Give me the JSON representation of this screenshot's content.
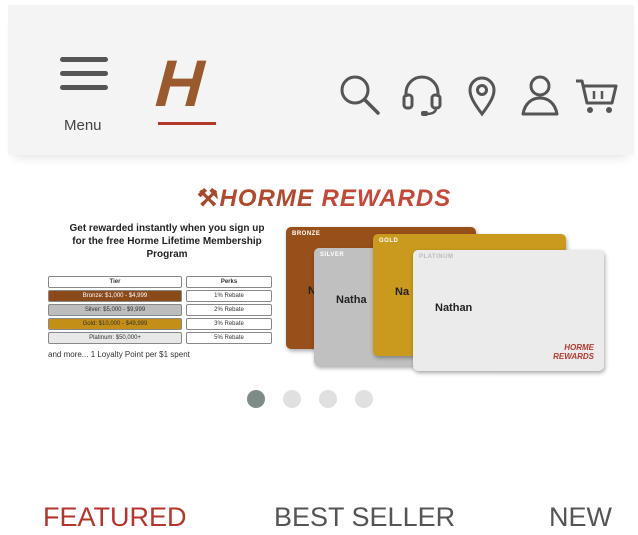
{
  "header": {
    "menu_label": "Menu",
    "logo_text": "H",
    "icons": [
      "search-icon",
      "support-headset-icon",
      "location-pin-icon",
      "account-icon",
      "cart-icon"
    ]
  },
  "banner": {
    "title_h": "HORME",
    "title_r": "REWARDS",
    "promo": "Get rewarded instantly when you sign up for the free Horme Lifetime Membership Program",
    "table_header": {
      "tier": "Tier",
      "perks": "Perks"
    },
    "table_rows": [
      {
        "tier": "Bronze: $1,000 - $4,999",
        "perks": "1% Rebate"
      },
      {
        "tier": "Silver: $5,000 - $9,999",
        "perks": "2% Rebate"
      },
      {
        "tier": "Gold: $10,000 - $49,999",
        "perks": "3% Rebate"
      },
      {
        "tier": "Platinum: $50,000+",
        "perks": "5% Rebate"
      }
    ],
    "footnote": "and more... 1 Loyalty Point per $1 spent",
    "cards": [
      {
        "tier": "BRONZE",
        "name": "N"
      },
      {
        "tier": "SILVER",
        "name": "Natha"
      },
      {
        "tier": "GOLD",
        "name": "Na"
      },
      {
        "tier": "PLATINUM",
        "name": "Nathan"
      }
    ],
    "card_brand_top": "HORME",
    "card_brand_bottom": "REWARDS"
  },
  "carousel": {
    "slide_count": 4,
    "active_index": 0
  },
  "tabs": [
    {
      "label": "FEATURED",
      "active": true
    },
    {
      "label": "BEST SELLER",
      "active": false
    },
    {
      "label": "NEW",
      "active": false
    }
  ],
  "colors": {
    "accent": "#b3352b",
    "logo": "#9a5a2e",
    "icon": "#555555",
    "dot_active": "#7d8c85",
    "dot_inactive": "#e0e0e0"
  }
}
